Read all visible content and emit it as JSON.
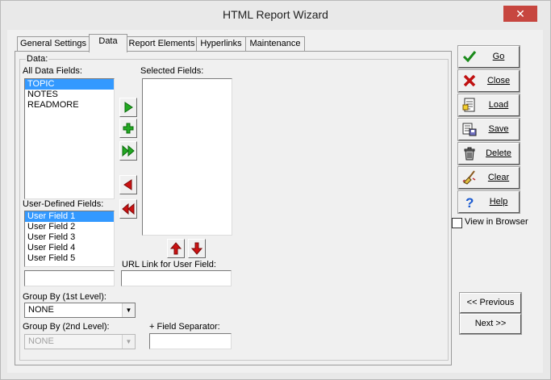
{
  "window": {
    "title": "HTML Report Wizard",
    "close_glyph": "✕"
  },
  "tabs": [
    {
      "label": "General Settings",
      "active": false
    },
    {
      "label": "Data",
      "active": true
    },
    {
      "label": "Report Elements",
      "active": false
    },
    {
      "label": "Hyperlinks",
      "active": false
    },
    {
      "label": "Maintenance",
      "active": false
    }
  ],
  "data_group": {
    "caption": "Data:",
    "all_fields": {
      "label": "All Data Fields:",
      "items": [
        "TOPIC",
        "NOTES",
        "READMORE"
      ],
      "selected_index": 0
    },
    "selected_fields": {
      "label": "Selected Fields:",
      "items": []
    },
    "user_fields": {
      "label": "User-Defined Fields:",
      "items": [
        "User Field 1",
        "User Field 2",
        "User Field 3",
        "User Field 4",
        "User Field 5"
      ],
      "selected_index": 0
    },
    "user_field_text": "",
    "url_link": {
      "label": "URL Link for User Field:",
      "value": ""
    },
    "group_by_1": {
      "label": "Group By (1st Level):",
      "value": "NONE"
    },
    "group_by_2": {
      "label": "Group By (2nd Level):",
      "value": "NONE"
    },
    "field_separator": {
      "label": "+ Field Separator:",
      "value": ""
    }
  },
  "side_buttons": {
    "go": "Go",
    "close": "Close",
    "load": "Load",
    "save": "Save",
    "delete": "Delete",
    "clear": "Clear",
    "help": "Help"
  },
  "view_in_browser": {
    "label": "View in Browser",
    "checked": false
  },
  "nav": {
    "previous": "<< Previous",
    "next": "Next >>"
  },
  "colors": {
    "selection": "#3399ff",
    "arrow_green": "#22a822",
    "arrow_red": "#cc1111",
    "close_red": "#c7463f"
  }
}
